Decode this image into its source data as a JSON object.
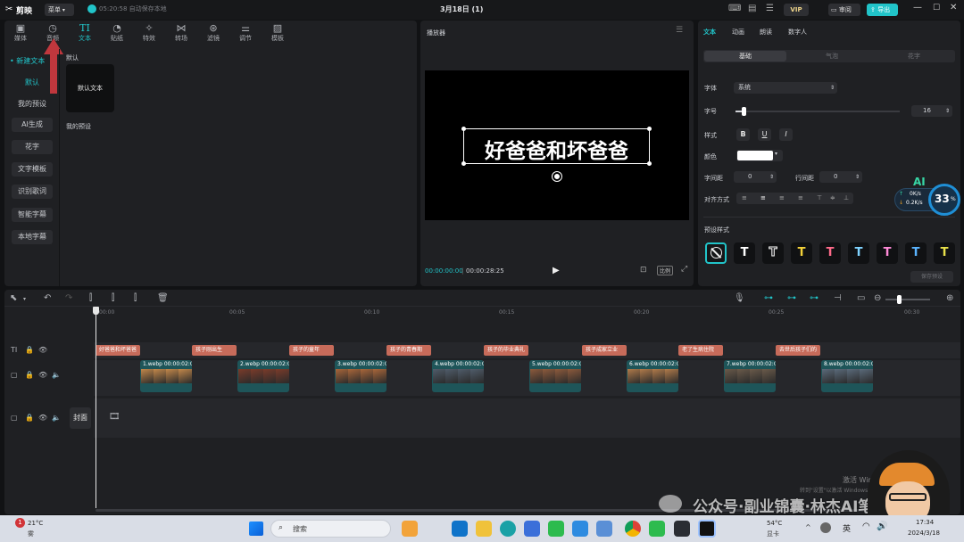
{
  "app": {
    "logo": "剪映",
    "menu": "菜单",
    "autosave": "05:20:58 自动保存本地",
    "title": "3月18日 (1)",
    "vip": "VIP",
    "review": "审阅",
    "export": "导出"
  },
  "library": {
    "nav": [
      {
        "label": "媒体",
        "icon": "media-icon"
      },
      {
        "label": "音频",
        "icon": "audio-icon"
      },
      {
        "label": "文本",
        "icon": "text-icon",
        "active": true
      },
      {
        "label": "贴纸",
        "icon": "sticker-icon"
      },
      {
        "label": "特效",
        "icon": "effects-icon"
      },
      {
        "label": "转场",
        "icon": "transition-icon"
      },
      {
        "label": "滤镜",
        "icon": "filter-icon"
      },
      {
        "label": "调节",
        "icon": "adjust-icon"
      },
      {
        "label": "模板",
        "icon": "template-icon"
      }
    ],
    "side": [
      "新建文本",
      "默认",
      "我的预设",
      "AI生成",
      "花字",
      "文字模板",
      "识别歌词",
      "智能字幕",
      "本地字幕"
    ],
    "section_default": "默认",
    "card_default_text": "默认文本",
    "section_presets": "我的预设"
  },
  "player": {
    "title": "播放器",
    "overlay_text": "好爸爸和坏爸爸",
    "time_current": "00:00:00:00",
    "time_total": "00:00:28:25",
    "ratio": "比例"
  },
  "props": {
    "tabs": [
      "文本",
      "动画",
      "朗读",
      "数字人"
    ],
    "subtabs": [
      "基础",
      "气泡",
      "花字"
    ],
    "font_label": "字体",
    "font_value": "系统",
    "size_label": "字号",
    "size_value": "16",
    "style_label": "样式",
    "style_b": "B",
    "style_u": "U",
    "style_i": "I",
    "color_label": "颜色",
    "char_spacing_label": "字间距",
    "char_spacing_value": "0",
    "line_spacing_label": "行间距",
    "line_spacing_value": "0",
    "align_label": "对齐方式",
    "preset_label": "预设样式",
    "preset_colors": [
      "#ffffff",
      "#ffffff",
      "#f4d23a",
      "#ff6b8a",
      "#7fd3ff",
      "#ff8ad8",
      "#5ab4ff",
      "#e8e04a"
    ],
    "save_preset": "保存预设",
    "ai_badge": "AI",
    "net_up": "0K/s",
    "net_down": "0.2K/s",
    "cpu_percent": "33",
    "cpu_unit": "%"
  },
  "timeline": {
    "ruler": [
      "00:00",
      "00:05",
      "00:10",
      "00:15",
      "00:20",
      "00:25",
      "00:30"
    ],
    "cover_label": "封面",
    "text_clips": [
      "好爸爸和坏爸爸",
      "孩子刚出生",
      "孩子的童年",
      "孩子的青春期",
      "孩子的毕业典礼",
      "孩子成家立业",
      "老了生病住院",
      "去世后孩子们的"
    ],
    "video_clips": [
      {
        "name": "1.webp",
        "dur": "00:00:02:0"
      },
      {
        "name": "2.webp",
        "dur": "00:00:02:0"
      },
      {
        "name": "3.webp",
        "dur": "00:00:02:0"
      },
      {
        "name": "4.webp",
        "dur": "00:00:02:0"
      },
      {
        "name": "5.webp",
        "dur": "00:00:02:0"
      },
      {
        "name": "6.webp",
        "dur": "00:00:02:0"
      },
      {
        "name": "7.webp",
        "dur": "00:00:02:0"
      },
      {
        "name": "8.webp",
        "dur": "00:00:02:0"
      }
    ]
  },
  "watermark": {
    "activate_line1": "激活 Windows",
    "activate_line2": "转到\"设置\"以激活 Windows。",
    "account": "公众号·副业锦囊·林杰AI笔记"
  },
  "taskbar": {
    "weather_temp": "21°C",
    "weather_desc": "雾",
    "search": "搜索",
    "cpu_temp": "54°C",
    "cpu_label": "显卡",
    "ime": "英",
    "time": "17:34",
    "date": "2024/3/18",
    "notif": "1"
  },
  "colors": {
    "accent": "#21c4c9",
    "text_clip": "#c76b5a",
    "video_clip": "#1e5559",
    "arrow": "#c0373d"
  }
}
